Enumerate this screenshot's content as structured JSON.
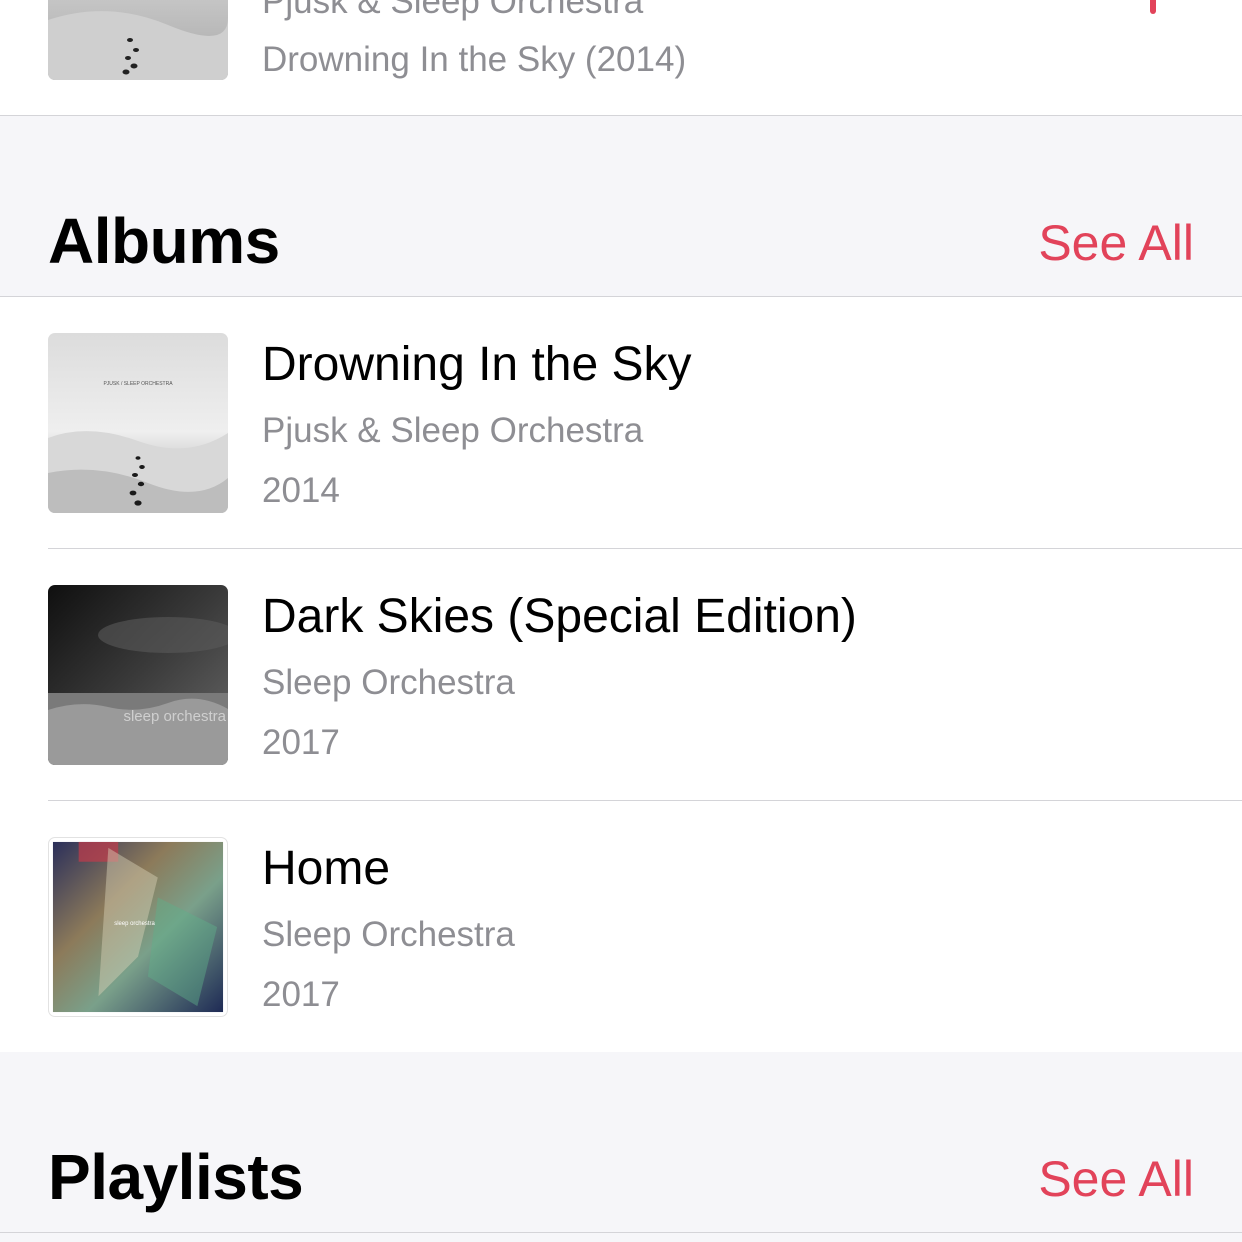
{
  "top_song": {
    "artist": "Pjusk & Sleep Orchestra",
    "album_line": "Drowning In the Sky (2014)"
  },
  "albums_section": {
    "title": "Albums",
    "see_all": "See All",
    "items": [
      {
        "title": "Drowning In the Sky",
        "artist": "Pjusk & Sleep Orchestra",
        "year": "2014",
        "art_text": "PJUSK / SLEEP ORCHESTRA"
      },
      {
        "title": "Dark Skies (Special Edition)",
        "artist": "Sleep Orchestra",
        "year": "2017",
        "art_text": "sleep orchestra"
      },
      {
        "title": "Home",
        "artist": "Sleep Orchestra",
        "year": "2017",
        "art_text": "sleep orchestra"
      }
    ]
  },
  "playlists_section": {
    "title": "Playlists",
    "see_all": "See All"
  },
  "colors": {
    "accent": "#e2435a",
    "secondary_text": "#8e8e93",
    "background": "#f6f6f9"
  }
}
